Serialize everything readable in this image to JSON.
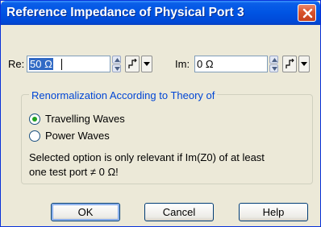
{
  "dialog": {
    "title": "Reference Impedance of Physical Port 3"
  },
  "re": {
    "label": "Re:",
    "value": "50 Ω"
  },
  "im": {
    "label": "Im:",
    "value": "0 Ω"
  },
  "group": {
    "title": "Renormalization According to Theory of",
    "options": [
      {
        "label": "Travelling Waves",
        "selected": true
      },
      {
        "label": "Power Waves",
        "selected": false
      }
    ],
    "note_line1": "Selected option is only relevant if Im(Z0) of at least",
    "note_line2": "one test port ≠ 0 Ω!"
  },
  "buttons": {
    "ok": "OK",
    "cancel": "Cancel",
    "help": "Help"
  },
  "icons": {
    "close": "close-icon",
    "spin_up": "spin-up-icon",
    "spin_down": "spin-down-icon",
    "unit": "unit-symbol-icon",
    "dropdown": "chevron-down-icon"
  },
  "colors": {
    "title_bar": "#0054e3",
    "window_bg": "#ece9d8",
    "group_title": "#0046d5",
    "selection": "#316ac5",
    "radio_dot": "#21a121",
    "close_button": "#d9532b"
  }
}
